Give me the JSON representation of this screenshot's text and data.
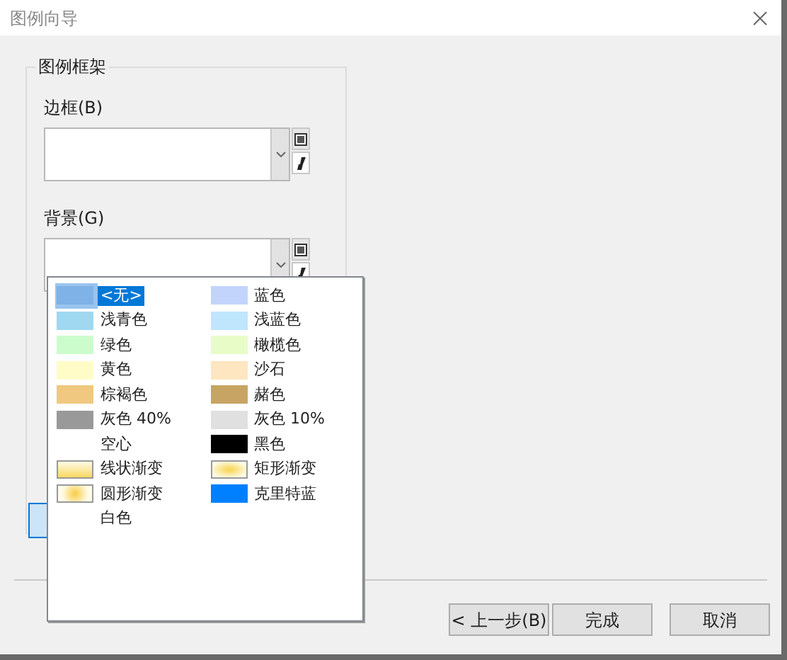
{
  "window": {
    "title": "图例向导"
  },
  "group": {
    "title": "图例框架",
    "fields": [
      {
        "label": "边框(B)"
      },
      {
        "label": "背景(G)"
      }
    ]
  },
  "dropdown": {
    "items": [
      {
        "name": "<无>",
        "kind": "solid",
        "color": "#7fb2e6",
        "selected": true
      },
      {
        "name": "蓝色",
        "kind": "solid",
        "color": "#c3d4fc",
        "selected": false
      },
      {
        "name": "浅青色",
        "kind": "solid",
        "color": "#9fd8f0",
        "selected": false
      },
      {
        "name": "浅蓝色",
        "kind": "solid",
        "color": "#bfe6fc",
        "selected": false
      },
      {
        "name": "绿色",
        "kind": "solid",
        "color": "#ccfccc",
        "selected": false
      },
      {
        "name": "橄榄色",
        "kind": "solid",
        "color": "#e8fcc8",
        "selected": false
      },
      {
        "name": "黄色",
        "kind": "solid",
        "color": "#fffcc8",
        "selected": false
      },
      {
        "name": "沙石",
        "kind": "solid",
        "color": "#fde6c0",
        "selected": false
      },
      {
        "name": "棕褐色",
        "kind": "solid",
        "color": "#f0c880",
        "selected": false
      },
      {
        "name": "赭色",
        "kind": "solid",
        "color": "#c8a464",
        "selected": false
      },
      {
        "name": "灰色 40%",
        "kind": "solid",
        "color": "#999999",
        "selected": false
      },
      {
        "name": "灰色 10%",
        "kind": "solid",
        "color": "#e0e0e0",
        "selected": false
      },
      {
        "name": "空心",
        "kind": "none",
        "selected": false
      },
      {
        "name": "黑色",
        "kind": "solid",
        "color": "#000000",
        "selected": false
      },
      {
        "name": "线状渐变",
        "kind": "linear",
        "selected": false
      },
      {
        "name": "矩形渐变",
        "kind": "rect",
        "selected": false
      },
      {
        "name": "圆形渐变",
        "kind": "radial",
        "selected": false
      },
      {
        "name": "克里特蓝",
        "kind": "solid",
        "color": "#0080ff",
        "selected": false
      },
      {
        "name": "白色",
        "kind": "none",
        "selected": false
      }
    ]
  },
  "buttons": [
    "< 上一步(B)",
    "完成",
    "取消"
  ]
}
